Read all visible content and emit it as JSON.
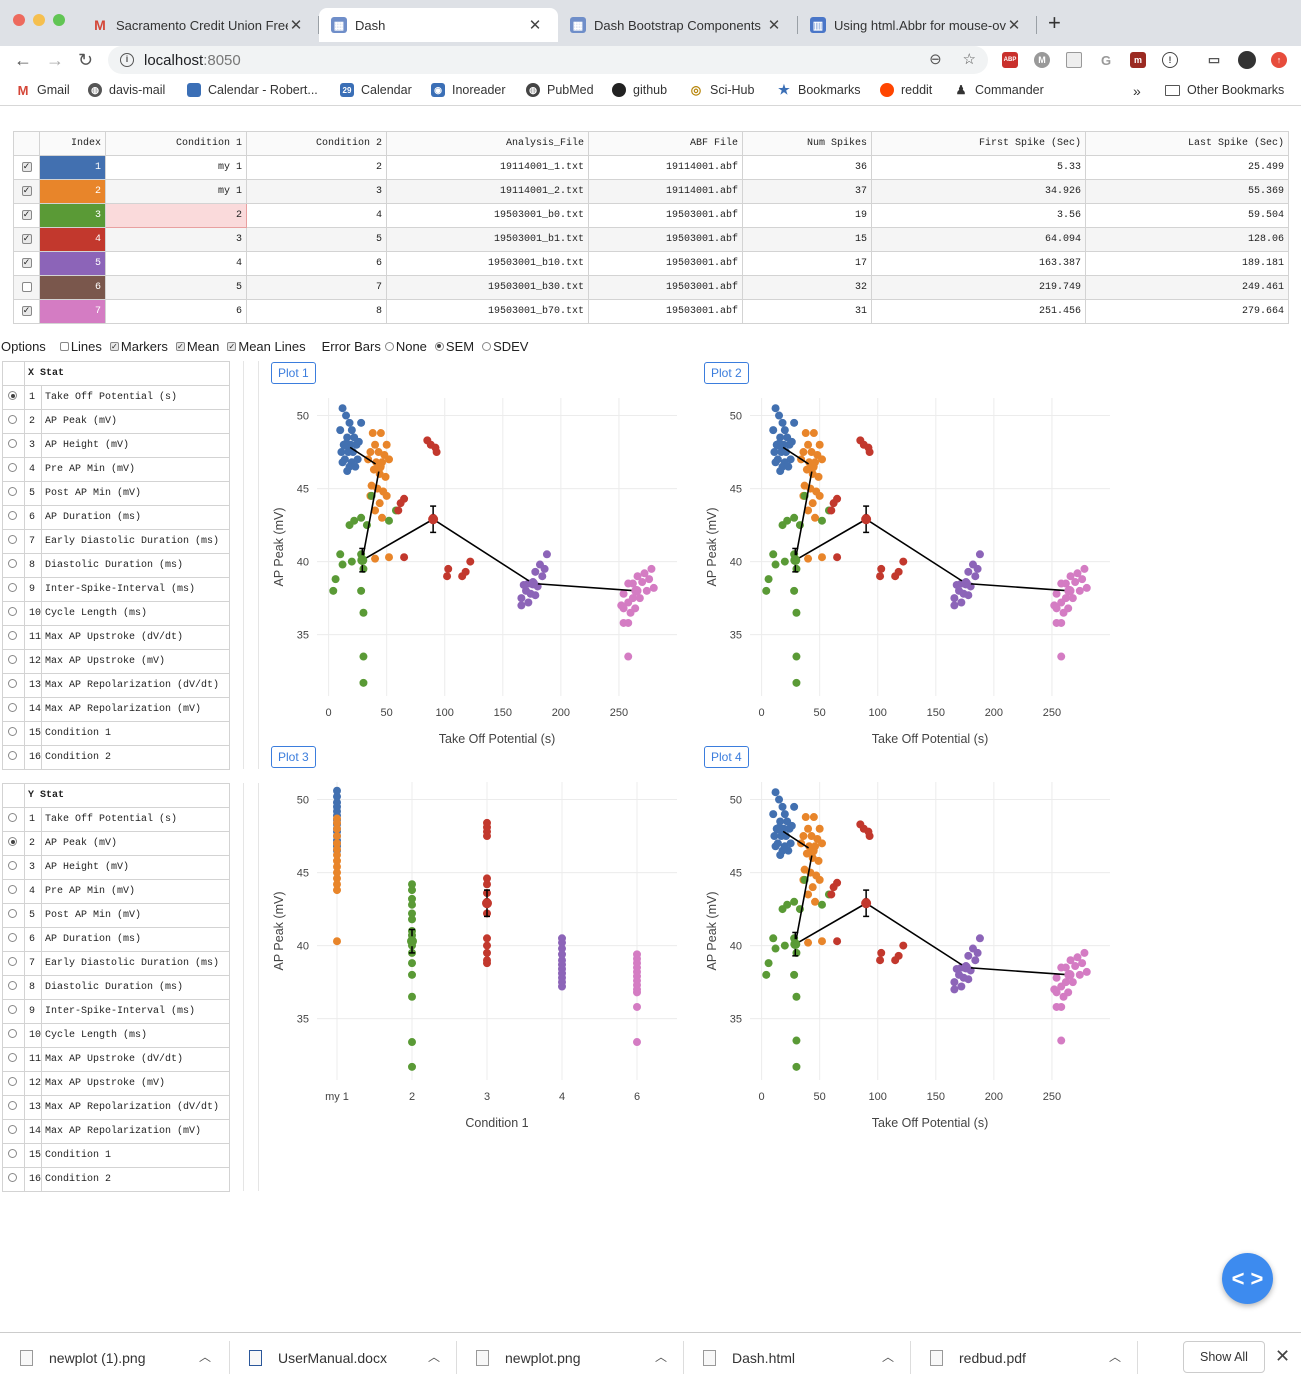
{
  "browser": {
    "tabs": [
      {
        "label": "Sacramento Credit Union Free",
        "icon": "gmail-icon",
        "active": false
      },
      {
        "label": "Dash",
        "icon": "dash-icon",
        "active": true
      },
      {
        "label": "Dash Bootstrap Components",
        "icon": "dash-icon",
        "active": false
      },
      {
        "label": "Using html.Abbr for mouse-ove",
        "icon": "chart-icon",
        "active": false
      }
    ],
    "url_host": "localhost",
    "url_port": ":8050",
    "bookmarks": [
      "Gmail",
      "davis-mail",
      "Calendar - Robert...",
      "Calendar",
      "Inoreader",
      "PubMed",
      "github",
      "Sci-Hub",
      "Bookmarks",
      "reddit",
      "Commander"
    ],
    "calendar_badge": "29",
    "bookmarks_more": "»",
    "other_bookmarks": "Other Bookmarks",
    "ext_abp": "ABP"
  },
  "colors": {
    "blue": "#4270b0",
    "orange": "#e8852a",
    "green": "#5a9a36",
    "red": "#c2382d",
    "purple": "#8c64b8",
    "brown": "#7a574c",
    "pink": "#d47cc3",
    "accent": "#3b7ddd"
  },
  "data_table": {
    "headers": [
      "Index",
      "Condition 1",
      "Condition 2",
      "Analysis_File",
      "ABF File",
      "Num Spikes",
      "First Spike (Sec)",
      "Last Spike (Sec)"
    ],
    "rows": [
      {
        "checked": true,
        "index": "1",
        "cond1": "my 1",
        "cond2": "2",
        "analysis": "19114001_1.txt",
        "abf": "19114001.abf",
        "spikes": "36",
        "first": "5.33",
        "last": "25.499",
        "color": "#4270b0"
      },
      {
        "checked": true,
        "index": "2",
        "cond1": "my 1",
        "cond2": "3",
        "analysis": "19114001_2.txt",
        "abf": "19114001.abf",
        "spikes": "37",
        "first": "34.926",
        "last": "55.369",
        "color": "#e8852a"
      },
      {
        "checked": true,
        "index": "3",
        "cond1": "2",
        "cond2": "4",
        "analysis": "19503001_b0.txt",
        "abf": "19503001.abf",
        "spikes": "19",
        "first": "3.56",
        "last": "59.504",
        "color": "#5a9a36"
      },
      {
        "checked": true,
        "index": "4",
        "cond1": "3",
        "cond2": "5",
        "analysis": "19503001_b1.txt",
        "abf": "19503001.abf",
        "spikes": "15",
        "first": "64.094",
        "last": "128.06",
        "color": "#c2382d"
      },
      {
        "checked": true,
        "index": "5",
        "cond1": "4",
        "cond2": "6",
        "analysis": "19503001_b10.txt",
        "abf": "19503001.abf",
        "spikes": "17",
        "first": "163.387",
        "last": "189.181",
        "color": "#8c64b8"
      },
      {
        "checked": false,
        "index": "6",
        "cond1": "5",
        "cond2": "7",
        "analysis": "19503001_b30.txt",
        "abf": "19503001.abf",
        "spikes": "32",
        "first": "219.749",
        "last": "249.461",
        "color": "#7a574c"
      },
      {
        "checked": true,
        "index": "7",
        "cond1": "6",
        "cond2": "8",
        "analysis": "19503001_b70.txt",
        "abf": "19503001.abf",
        "spikes": "31",
        "first": "251.456",
        "last": "279.664",
        "color": "#d47cc3"
      }
    ]
  },
  "options": {
    "title": "Options",
    "checkboxes": [
      {
        "label": "Lines",
        "checked": false
      },
      {
        "label": "Markers",
        "checked": true
      },
      {
        "label": "Mean",
        "checked": true
      },
      {
        "label": "Mean Lines",
        "checked": true
      }
    ],
    "error_bars_label": "Error Bars",
    "radios": [
      {
        "label": "None",
        "checked": false
      },
      {
        "label": "SEM",
        "checked": true
      },
      {
        "label": "SDEV",
        "checked": false
      }
    ]
  },
  "x_stat": {
    "header": "X Stat",
    "selected": 1,
    "items": [
      "Take Off Potential (s)",
      "AP Peak (mV)",
      "AP Height (mV)",
      "Pre AP Min (mV)",
      "Post AP Min (mV)",
      "AP Duration (ms)",
      "Early Diastolic Duration (ms)",
      "Diastolic Duration (ms)",
      "Inter-Spike-Interval (ms)",
      "Cycle Length (ms)",
      "Max AP Upstroke (dV/dt)",
      "Max AP Upstroke (mV)",
      "Max AP Repolarization (dV/dt)",
      "Max AP Repolarization (mV)",
      "Condition 1",
      "Condition 2"
    ]
  },
  "y_stat": {
    "header": "Y Stat",
    "selected": 2,
    "items": [
      "Take Off Potential (s)",
      "AP Peak (mV)",
      "AP Height (mV)",
      "Pre AP Min (mV)",
      "Post AP Min (mV)",
      "AP Duration (ms)",
      "Early Diastolic Duration (ms)",
      "Diastolic Duration (ms)",
      "Inter-Spike-Interval (ms)",
      "Cycle Length (ms)",
      "Max AP Upstroke (dV/dt)",
      "Max AP Upstroke (mV)",
      "Max AP Repolarization (dV/dt)",
      "Max AP Repolarization (mV)",
      "Condition 1",
      "Condition 2"
    ]
  },
  "plot_buttons": [
    "Plot 1",
    "Plot 2",
    "Plot 3",
    "Plot 4"
  ],
  "chart_data": [
    {
      "type": "scatter",
      "xlabel": "Take Off Potential (s)",
      "ylabel": "AP Peak (mV)",
      "xticks": [
        0,
        50,
        100,
        150,
        200,
        250
      ],
      "yticks": [
        35,
        40,
        45,
        50
      ],
      "xlim": [
        -10,
        300
      ],
      "ylim": [
        30.8,
        51.2
      ],
      "grid": true,
      "series": [
        {
          "color": "#4270b0",
          "points": [
            [
              12,
              50.5
            ],
            [
              15,
              50
            ],
            [
              18,
              49.5
            ],
            [
              10,
              49
            ],
            [
              20,
              49
            ],
            [
              16,
              48.5
            ],
            [
              22,
              48.5
            ],
            [
              13,
              48
            ],
            [
              19,
              48
            ],
            [
              24,
              48
            ],
            [
              11,
              47.5
            ],
            [
              17,
              47.5
            ],
            [
              21,
              47.5
            ],
            [
              14,
              47
            ],
            [
              20,
              46.8
            ],
            [
              25,
              47
            ],
            [
              12,
              46.8
            ],
            [
              18,
              46.5
            ],
            [
              23,
              46.5
            ],
            [
              16,
              46.2
            ],
            [
              28,
              49.5
            ],
            [
              26,
              48.2
            ]
          ]
        },
        {
          "color": "#e8852a",
          "points": [
            [
              38,
              48.8
            ],
            [
              45,
              48.8
            ],
            [
              40,
              48
            ],
            [
              50,
              48
            ],
            [
              36,
              47.5
            ],
            [
              43,
              47.5
            ],
            [
              48,
              47.3
            ],
            [
              34,
              47
            ],
            [
              41,
              46.8
            ],
            [
              46,
              46.8
            ],
            [
              52,
              47
            ],
            [
              39,
              46.3
            ],
            [
              44,
              46
            ],
            [
              49,
              45.8
            ],
            [
              37,
              45.2
            ],
            [
              42,
              45
            ],
            [
              47,
              44.8
            ],
            [
              50,
              44.5
            ],
            [
              36,
              44.5
            ],
            [
              44,
              44
            ],
            [
              40,
              43.5
            ],
            [
              46,
              43
            ],
            [
              52,
              40.3
            ],
            [
              40,
              40.2
            ]
          ]
        },
        {
          "color": "#5a9a36",
          "points": [
            [
              37,
              44.5
            ],
            [
              58,
              43.5
            ],
            [
              52,
              42.8
            ],
            [
              28,
              43
            ],
            [
              22,
              42.8
            ],
            [
              18,
              42.5
            ],
            [
              33,
              42.5
            ],
            [
              10,
              40.5
            ],
            [
              28,
              40.5
            ],
            [
              20,
              40
            ],
            [
              12,
              39.8
            ],
            [
              30,
              39.5
            ],
            [
              6,
              38.8
            ],
            [
              28,
              38
            ],
            [
              4,
              38
            ],
            [
              30,
              36.5
            ],
            [
              30,
              33.5
            ],
            [
              30,
              31.7
            ]
          ]
        },
        {
          "color": "#c2382d",
          "points": [
            [
              85,
              48.3
            ],
            [
              88,
              48
            ],
            [
              92,
              47.8
            ],
            [
              93,
              47.5
            ],
            [
              65,
              44.3
            ],
            [
              62,
              44
            ],
            [
              60,
              43.5
            ],
            [
              65,
              40.3
            ],
            [
              103,
              39.5
            ],
            [
              102,
              39
            ],
            [
              122,
              40
            ],
            [
              118,
              39.3
            ],
            [
              115,
              39
            ],
            [
              90,
              43
            ]
          ]
        },
        {
          "color": "#8c64b8",
          "points": [
            [
              188,
              40.5
            ],
            [
              182,
              39.8
            ],
            [
              186,
              39.5
            ],
            [
              178,
              39.3
            ],
            [
              184,
              39
            ],
            [
              172,
              38.5
            ],
            [
              176,
              38.6
            ],
            [
              168,
              38.4
            ],
            [
              180,
              38.3
            ],
            [
              170,
              38
            ],
            [
              174,
              37.8
            ],
            [
              166,
              37.5
            ],
            [
              178,
              37.7
            ],
            [
              172,
              37.2
            ],
            [
              166,
              37
            ]
          ]
        },
        {
          "color": "#d47cc3",
          "points": [
            [
              278,
              39.5
            ],
            [
              272,
              39.2
            ],
            [
              266,
              39
            ],
            [
              276,
              38.8
            ],
            [
              262,
              38.5
            ],
            [
              270,
              38.6
            ],
            [
              280,
              38.2
            ],
            [
              258,
              38.5
            ],
            [
              266,
              38
            ],
            [
              274,
              38
            ],
            [
              254,
              37.8
            ],
            [
              262,
              37.5
            ],
            [
              258,
              37.2
            ],
            [
              268,
              37.5
            ],
            [
              252,
              37
            ],
            [
              264,
              36.8
            ],
            [
              260,
              36.5
            ],
            [
              254,
              36.8
            ],
            [
              258,
              35.8
            ],
            [
              254,
              35.8
            ],
            [
              258,
              33.5
            ]
          ]
        }
      ],
      "means": [
        {
          "color": "#4270b0",
          "x": 15,
          "y": 48
        },
        {
          "color": "#e8852a",
          "x": 44,
          "y": 46.5
        },
        {
          "color": "#5a9a36",
          "x": 29,
          "y": 40.1,
          "err": 0.8
        },
        {
          "color": "#c2382d",
          "x": 90,
          "y": 42.9,
          "err": 0.9
        },
        {
          "color": "#8c64b8",
          "x": 176,
          "y": 38.5
        },
        {
          "color": "#d47cc3",
          "x": 265,
          "y": 38.0
        }
      ]
    },
    {
      "type": "scatter",
      "xlabel": "Take Off Potential (s)",
      "ylabel": "AP Peak (mV)",
      "xticks": [
        0,
        50,
        100,
        150,
        200,
        250
      ],
      "yticks": [
        35,
        40,
        45,
        50
      ],
      "xlim": [
        -10,
        300
      ],
      "ylim": [
        30.8,
        51.2
      ],
      "grid": true,
      "series": "same-as-plot-1"
    },
    {
      "type": "scatter",
      "xlabel": "Condition 1",
      "ylabel": "AP Peak (mV)",
      "categories": [
        "my 1",
        "2",
        "3",
        "4",
        "6"
      ],
      "yticks": [
        35,
        40,
        45,
        50
      ],
      "ylim": [
        30.8,
        51.2
      ],
      "grid": true,
      "series": [
        {
          "color": "#4270b0",
          "category": "my 1",
          "values": [
            50.6,
            50.2,
            49.8,
            49.5,
            49.2,
            48.9,
            48.6,
            48.3,
            48.0,
            47.8,
            47.5,
            47.2,
            47.0,
            46.8,
            46.5
          ]
        },
        {
          "color": "#e8852a",
          "category": "my 1",
          "values": [
            48.7,
            48.4,
            48.0,
            47.5,
            47.0,
            46.6,
            46.2,
            45.8,
            45.4,
            45.0,
            44.6,
            44.2,
            43.8,
            40.3
          ]
        },
        {
          "color": "#5a9a36",
          "category": "2",
          "values": [
            44.2,
            43.8,
            43.2,
            42.8,
            42.2,
            41.8,
            41.0,
            40.7,
            40.4,
            40.0,
            39.5,
            38.8,
            38.0,
            36.5,
            33.4,
            31.7
          ]
        },
        {
          "color": "#c2382d",
          "category": "3",
          "values": [
            48.4,
            48.1,
            47.8,
            47.5,
            44.6,
            44.2,
            43.6,
            43.0,
            42.2,
            40.5,
            40.0,
            39.5,
            39.0,
            38.8
          ]
        },
        {
          "color": "#8c64b8",
          "category": "4",
          "values": [
            40.5,
            40.2,
            39.8,
            39.4,
            39.0,
            38.7,
            38.4,
            38.1,
            37.8,
            37.5,
            37.2
          ]
        },
        {
          "color": "#d47cc3",
          "category": "6",
          "values": [
            39.4,
            39.1,
            38.8,
            38.5,
            38.2,
            37.9,
            37.6,
            37.3,
            37.0,
            36.8,
            35.8,
            33.4
          ]
        }
      ],
      "means": [
        {
          "color": "#5a9a36",
          "category": "2",
          "y": 40.3,
          "err": 0.8
        },
        {
          "color": "#c2382d",
          "category": "3",
          "y": 42.9,
          "err": 0.9
        }
      ]
    },
    {
      "type": "scatter",
      "xlabel": "Take Off Potential (s)",
      "ylabel": "AP Peak (mV)",
      "xticks": [
        0,
        50,
        100,
        150,
        200,
        250
      ],
      "yticks": [
        35,
        40,
        45,
        50
      ],
      "xlim": [
        -10,
        300
      ],
      "ylim": [
        30.8,
        51.2
      ],
      "grid": true,
      "series": "same-as-plot-1"
    }
  ],
  "fab_label": "< >",
  "downloads": [
    {
      "name": "newplot (1).png"
    },
    {
      "name": "UserManual.docx"
    },
    {
      "name": "newplot.png"
    },
    {
      "name": "Dash.html"
    },
    {
      "name": "redbud.pdf"
    }
  ],
  "show_all": "Show All"
}
